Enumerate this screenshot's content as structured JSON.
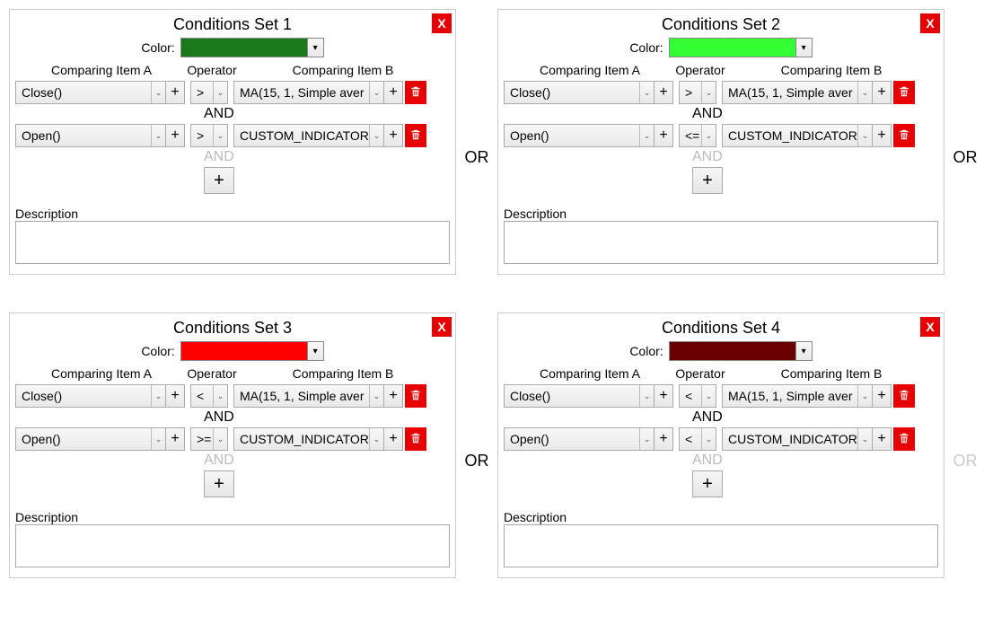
{
  "labels": {
    "color": "Color:",
    "comparing_a": "Comparing Item A",
    "operator": "Operator",
    "comparing_b": "Comparing Item B",
    "and": "AND",
    "or": "OR",
    "description": "Description",
    "close": "X",
    "plus": "+"
  },
  "sets": [
    {
      "title": "Conditions Set 1",
      "color": "#1a7a1a",
      "rows": [
        {
          "a": "Close()",
          "op": ">",
          "b": "MA(15, 1, Simple aver"
        },
        {
          "a": "Open()",
          "op": ">",
          "b": "CUSTOM_INDICATOR("
        }
      ],
      "description": ""
    },
    {
      "title": "Conditions Set 2",
      "color": "#33ff33",
      "rows": [
        {
          "a": "Close()",
          "op": ">",
          "b": "MA(15, 1, Simple aver"
        },
        {
          "a": "Open()",
          "op": "<=",
          "b": "CUSTOM_INDICATOR("
        }
      ],
      "description": ""
    },
    {
      "title": "Conditions Set 3",
      "color": "#ff0000",
      "rows": [
        {
          "a": "Close()",
          "op": "<",
          "b": "MA(15, 1, Simple aver"
        },
        {
          "a": "Open()",
          "op": ">=",
          "b": "CUSTOM_INDICATOR("
        }
      ],
      "description": ""
    },
    {
      "title": "Conditions Set 4",
      "color": "#6b0000",
      "rows": [
        {
          "a": "Close()",
          "op": "<",
          "b": "MA(15, 1, Simple aver"
        },
        {
          "a": "Open()",
          "op": "<",
          "b": "CUSTOM_INDICATOR("
        }
      ],
      "description": ""
    }
  ],
  "or_between": [
    true,
    true,
    true,
    false
  ]
}
